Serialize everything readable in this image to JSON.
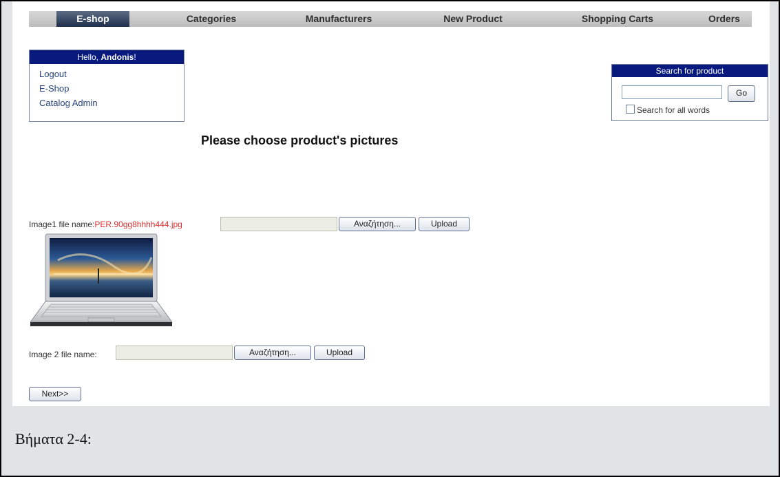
{
  "nav": {
    "items": [
      "E-shop",
      "Categories",
      "Manufacturers",
      "New Product",
      "Shopping Carts",
      "Orders"
    ],
    "active": "E-shop"
  },
  "login_box": {
    "greeting_prefix": "Hello, ",
    "user_name": "Andonis",
    "greeting_suffix": "!",
    "links": [
      "Logout",
      "E-Shop",
      "Catalog Admin"
    ]
  },
  "search": {
    "title": "Search for product",
    "input_value": "",
    "go_label": "Go",
    "all_words_label": "Search for all words",
    "all_words_checked": false
  },
  "main": {
    "heading": "Please choose product's pictures",
    "image1": {
      "label": "Image1 file name:",
      "filename": "PER.90gg8hhhh444.jpg",
      "browse_label": "Αναζήτηση...",
      "upload_label": "Upload"
    },
    "image2": {
      "label": "Image 2 file name:",
      "browse_label": "Αναζήτηση...",
      "upload_label": "Upload"
    },
    "next_label": "Next>>"
  },
  "caption": "Βήματα 2-4:",
  "colors": {
    "header_blue": "#081a7d",
    "filename_red": "#e03030",
    "frame_gray": "#e1e4e7"
  }
}
